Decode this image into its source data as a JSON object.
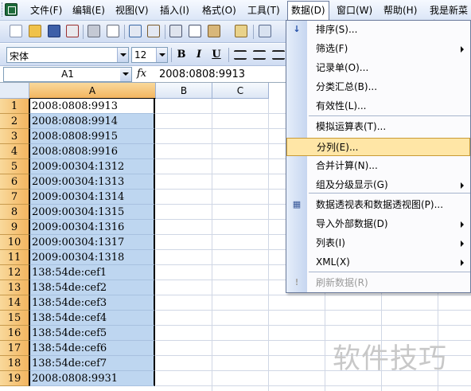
{
  "menubar": {
    "items": [
      {
        "label": "文件(F)"
      },
      {
        "label": "编辑(E)"
      },
      {
        "label": "视图(V)"
      },
      {
        "label": "插入(I)"
      },
      {
        "label": "格式(O)"
      },
      {
        "label": "工具(T)"
      },
      {
        "label": "数据(D)"
      },
      {
        "label": "窗口(W)"
      },
      {
        "label": "帮助(H)"
      },
      {
        "label": "我是新菜鸟"
      }
    ]
  },
  "format_toolbar": {
    "font": "宋体",
    "size": "12",
    "bold": "B",
    "italic": "I",
    "underline": "U"
  },
  "formula_bar": {
    "name_box": "A1",
    "fx": "fx",
    "formula": "2008:0808:9913"
  },
  "columns": [
    "A",
    "B",
    "C"
  ],
  "rows": [
    {
      "num": "1",
      "a": "2008:0808:9913"
    },
    {
      "num": "2",
      "a": "2008:0808:9914"
    },
    {
      "num": "3",
      "a": "2008:0808:9915"
    },
    {
      "num": "4",
      "a": "2008:0808:9916"
    },
    {
      "num": "5",
      "a": "2009:00304:1312"
    },
    {
      "num": "6",
      "a": "2009:00304:1313"
    },
    {
      "num": "7",
      "a": "2009:00304:1314"
    },
    {
      "num": "8",
      "a": "2009:00304:1315"
    },
    {
      "num": "9",
      "a": "2009:00304:1316"
    },
    {
      "num": "10",
      "a": "2009:00304:1317"
    },
    {
      "num": "11",
      "a": "2009:00304:1318"
    },
    {
      "num": "12",
      "a": "138:54de:cef1"
    },
    {
      "num": "13",
      "a": "138:54de:cef2"
    },
    {
      "num": "14",
      "a": "138:54de:cef3"
    },
    {
      "num": "15",
      "a": "138:54de:cef4"
    },
    {
      "num": "16",
      "a": "138:54de:cef5"
    },
    {
      "num": "17",
      "a": "138:54de:cef6"
    },
    {
      "num": "18",
      "a": "138:54de:cef7"
    },
    {
      "num": "19",
      "a": "2008:0808:9931"
    }
  ],
  "data_menu": {
    "items": [
      {
        "label": "排序(S)...",
        "icon": "sort-az-icon"
      },
      {
        "label": "筛选(F)",
        "submenu": true
      },
      {
        "label": "记录单(O)..."
      },
      {
        "label": "分类汇总(B)..."
      },
      {
        "label": "有效性(L)..."
      },
      {
        "label": "模拟运算表(T)..."
      },
      {
        "label": "分列(E)...",
        "highlighted": true
      },
      {
        "label": "合并计算(N)..."
      },
      {
        "label": "组及分级显示(G)",
        "submenu": true
      },
      {
        "label": "数据透视表和数据透视图(P)...",
        "icon": "pivot-table-icon"
      },
      {
        "label": "导入外部数据(D)",
        "submenu": true
      },
      {
        "label": "列表(I)",
        "submenu": true
      },
      {
        "label": "XML(X)",
        "submenu": true
      },
      {
        "label": "刷新数据(R)",
        "disabled": true,
        "icon": "refresh-icon"
      }
    ]
  },
  "watermark": "软件技巧",
  "colors": {
    "selection": "#bed6f0",
    "header_selected": "#f3b560",
    "menu_highlight": "#ffe6a6"
  }
}
